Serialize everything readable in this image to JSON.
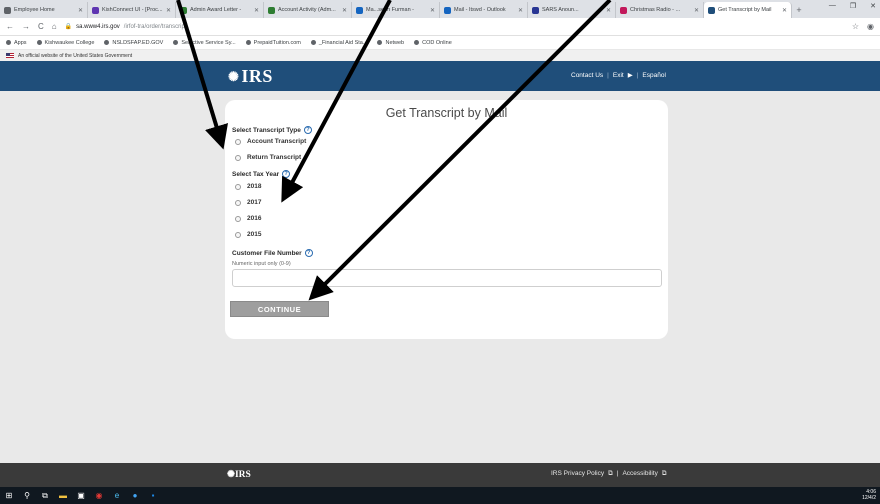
{
  "browser": {
    "tabs": [
      {
        "title": "Employee Home",
        "color": "#5f6368"
      },
      {
        "title": "KishConnect UI - [Proc...",
        "color": "#5e35b1"
      },
      {
        "title": "Admin Award Letter -",
        "color": "#2e7d32"
      },
      {
        "title": "Account Activity (Adm...",
        "color": "#2e7d32"
      },
      {
        "title": "Ma...sean Furman -",
        "color": "#1565c0"
      },
      {
        "title": "Mail - Itswd - Outlook",
        "color": "#1565c0"
      },
      {
        "title": "SARS Anoun...",
        "color": "#283593"
      },
      {
        "title": "Christmas Radio - ...",
        "color": "#c2185b"
      },
      {
        "title": "Get Transcript by Mail",
        "color": "#1f4e7a",
        "active": true
      }
    ],
    "new_tab": "+",
    "url_host": "sa.www4.irs.gov",
    "url_path": "/irfof-tra/order/transcript",
    "bookmarks": [
      "Apps",
      "Kishwaukee College",
      "NSLDSFAP.ED.GOV",
      "Selective Service Sy...",
      "PrepaidTuition.com",
      "_Financial Aid Sta...",
      "Netweb",
      "COD Online"
    ]
  },
  "gov_banner": "An official website of the United States Government",
  "header": {
    "logo": "IRS",
    "contact": "Contact Us",
    "exit": "Exit",
    "espanol": "Español"
  },
  "form": {
    "title": "Get Transcript by Mail",
    "transcript_type_label": "Select Transcript Type",
    "transcript_types": [
      "Account Transcript",
      "Return Transcript"
    ],
    "tax_year_label": "Select Tax Year",
    "tax_years": [
      "2018",
      "2017",
      "2016",
      "2015"
    ],
    "customer_file_label": "Customer File Number",
    "customer_file_hint": "Numeric input only (0-9)",
    "continue_label": "CONTINUE"
  },
  "footer": {
    "logo": "IRS",
    "privacy": "IRS Privacy Policy",
    "accessibility": "Accessibility"
  },
  "taskbar": {
    "time": "4:06",
    "date": "12/4/2"
  }
}
